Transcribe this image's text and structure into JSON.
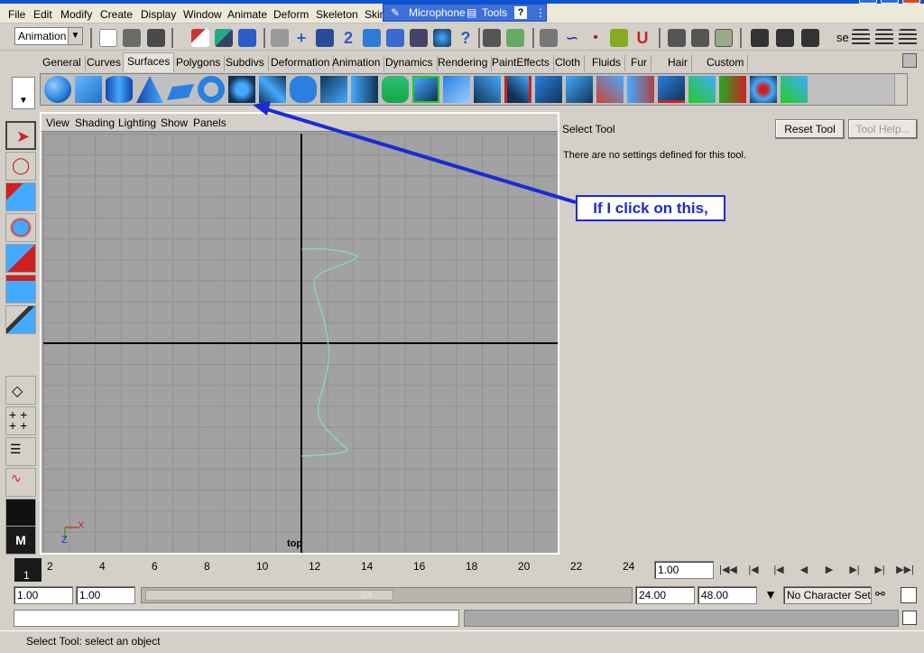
{
  "menubar": {
    "items": [
      "File",
      "Edit",
      "Modify",
      "Create",
      "Display",
      "Window",
      "Animate",
      "Deform",
      "Skeleton",
      "Skin"
    ]
  },
  "langbar": {
    "microphone": "Microphone",
    "tools": "Tools",
    "help": "?"
  },
  "toolbar": {
    "mode_select": "Animation",
    "se_label": "se"
  },
  "shelf_tabs": [
    "General",
    "Curves",
    "Surfaces",
    "Polygons",
    "Subdivs",
    "Deformation",
    "Animation",
    "Dynamics",
    "Rendering",
    "PaintEffects",
    "Cloth",
    "Fluids",
    "Fur",
    "Hair",
    "Custom"
  ],
  "shelf_active_tab": "Surfaces",
  "viewport": {
    "menus": [
      "View",
      "Shading",
      "Lighting",
      "Show",
      "Panels"
    ],
    "camera_label": "top",
    "axis_x": "X",
    "axis_z": "Z"
  },
  "attribute_editor": {
    "title": "Select Tool",
    "reset_button": "Reset Tool",
    "help_button": "Tool Help...",
    "message": "There are no settings defined for this tool."
  },
  "annotation": {
    "text": "If I click on this,",
    "color": "#1b2bd6"
  },
  "timeline": {
    "current_frame": "1",
    "ticks": [
      "2",
      "4",
      "6",
      "8",
      "10",
      "12",
      "14",
      "16",
      "18",
      "20",
      "22",
      "24"
    ],
    "current_time_field": "1.00"
  },
  "range": {
    "start": "1.00",
    "playback_start": "1.00",
    "slider_end_label": "24",
    "playback_end": "24.00",
    "end": "48.00",
    "character_set": "No Character Set"
  },
  "status": {
    "help_line": "Select Tool: select an object"
  },
  "colors": {
    "curve": "#7fe0c8",
    "viewport_bg": "#a2a2a2",
    "surface_icon": "#1f7fd8"
  }
}
